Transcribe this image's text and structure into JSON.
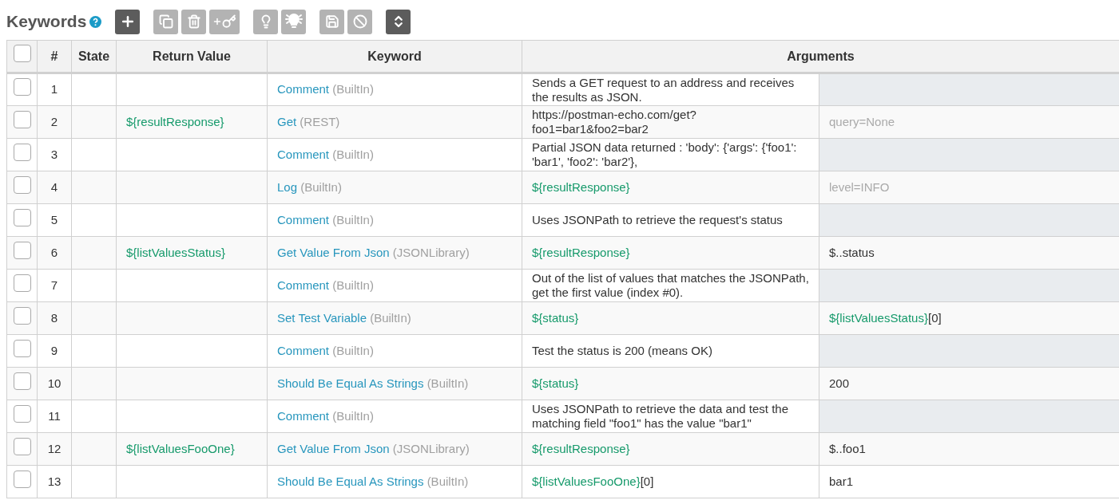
{
  "title": "Keywords",
  "toolbar": [
    [
      {
        "kind": "add",
        "disabled": false
      }
    ],
    [
      {
        "kind": "copy",
        "disabled": true
      },
      {
        "kind": "delete",
        "disabled": true
      },
      {
        "kind": "add-key",
        "disabled": true
      }
    ],
    [
      {
        "kind": "bulb",
        "disabled": true
      },
      {
        "kind": "bulb-on",
        "disabled": true
      }
    ],
    [
      {
        "kind": "save",
        "disabled": true
      },
      {
        "kind": "cancel",
        "disabled": true
      }
    ],
    [
      {
        "kind": "sort",
        "disabled": false
      }
    ]
  ],
  "table": {
    "select_all": {
      "checked": false
    },
    "columns": [
      "#",
      "State",
      "Return Value",
      "Keyword",
      "Arguments"
    ],
    "rows": [
      {
        "checked": false,
        "number": "1",
        "return_value": "",
        "keyword": {
          "name": "Comment",
          "library": "(BuiltIn)"
        },
        "arguments": [
          {
            "kind": "text",
            "segments": [
              {
                "text": "Sends a GET request to an address and receives the results as JSON.",
                "kind": "text"
              }
            ]
          },
          {
            "kind": "blank"
          }
        ]
      },
      {
        "checked": false,
        "number": "2",
        "return_value": "${resultResponse}",
        "keyword": {
          "name": "Get",
          "library": "(REST)"
        },
        "arguments": [
          {
            "kind": "text",
            "segments": [
              {
                "text": "https://postman-echo.com/get?foo1=bar1&foo2=bar2",
                "kind": "text"
              }
            ]
          },
          {
            "kind": "text",
            "segments": [
              {
                "text": "query=None",
                "kind": "default"
              }
            ]
          }
        ]
      },
      {
        "checked": false,
        "number": "3",
        "return_value": "",
        "keyword": {
          "name": "Comment",
          "library": "(BuiltIn)"
        },
        "arguments": [
          {
            "kind": "text",
            "segments": [
              {
                "text": "Partial JSON data returned : 'body': {'args': {'foo1': 'bar1', 'foo2': 'bar2'},",
                "kind": "text"
              }
            ]
          },
          {
            "kind": "blank"
          }
        ]
      },
      {
        "checked": false,
        "number": "4",
        "return_value": "",
        "keyword": {
          "name": "Log",
          "library": "(BuiltIn)"
        },
        "arguments": [
          {
            "kind": "text",
            "segments": [
              {
                "text": "${resultResponse}",
                "kind": "variable"
              }
            ]
          },
          {
            "kind": "text",
            "segments": [
              {
                "text": "level=INFO",
                "kind": "default"
              }
            ]
          }
        ]
      },
      {
        "checked": false,
        "number": "5",
        "return_value": "",
        "keyword": {
          "name": "Comment",
          "library": "(BuiltIn)"
        },
        "arguments": [
          {
            "kind": "text",
            "segments": [
              {
                "text": "Uses JSONPath to retrieve the request's status",
                "kind": "text"
              }
            ]
          },
          {
            "kind": "blank"
          }
        ]
      },
      {
        "checked": false,
        "number": "6",
        "return_value": "${listValuesStatus}",
        "keyword": {
          "name": "Get Value From Json",
          "library": "(JSONLibrary)"
        },
        "arguments": [
          {
            "kind": "text",
            "segments": [
              {
                "text": "${resultResponse}",
                "kind": "variable"
              }
            ]
          },
          {
            "kind": "text",
            "segments": [
              {
                "text": "$..status",
                "kind": "text"
              }
            ]
          }
        ]
      },
      {
        "checked": false,
        "number": "7",
        "return_value": "",
        "keyword": {
          "name": "Comment",
          "library": "(BuiltIn)"
        },
        "arguments": [
          {
            "kind": "text",
            "segments": [
              {
                "text": "Out of the list of values that matches the JSONPath, get the first value (index #0).",
                "kind": "text"
              }
            ]
          },
          {
            "kind": "blank"
          }
        ]
      },
      {
        "checked": false,
        "number": "8",
        "return_value": "",
        "keyword": {
          "name": "Set Test Variable",
          "library": "(BuiltIn)"
        },
        "arguments": [
          {
            "kind": "text",
            "segments": [
              {
                "text": "${status}",
                "kind": "variable"
              }
            ]
          },
          {
            "kind": "text",
            "segments": [
              {
                "text": "${listValuesStatus}",
                "kind": "variable"
              },
              {
                "text": "[0]",
                "kind": "text"
              }
            ]
          }
        ]
      },
      {
        "checked": false,
        "number": "9",
        "return_value": "",
        "keyword": {
          "name": "Comment",
          "library": "(BuiltIn)"
        },
        "arguments": [
          {
            "kind": "text",
            "segments": [
              {
                "text": "Test the status is 200 (means OK)",
                "kind": "text"
              }
            ]
          },
          {
            "kind": "blank"
          }
        ]
      },
      {
        "checked": false,
        "number": "10",
        "return_value": "",
        "keyword": {
          "name": "Should Be Equal As Strings",
          "library": "(BuiltIn)"
        },
        "arguments": [
          {
            "kind": "text",
            "segments": [
              {
                "text": "${status}",
                "kind": "variable"
              }
            ]
          },
          {
            "kind": "text",
            "segments": [
              {
                "text": "200",
                "kind": "text"
              }
            ]
          }
        ]
      },
      {
        "checked": false,
        "number": "11",
        "return_value": "",
        "keyword": {
          "name": "Comment",
          "library": "(BuiltIn)"
        },
        "arguments": [
          {
            "kind": "text",
            "segments": [
              {
                "text": "Uses JSONPath to retrieve the data and test the matching field \"foo1\" has the value \"bar1\"",
                "kind": "text"
              }
            ]
          },
          {
            "kind": "blank"
          }
        ]
      },
      {
        "checked": false,
        "number": "12",
        "return_value": "${listValuesFooOne}",
        "keyword": {
          "name": "Get Value From Json",
          "library": "(JSONLibrary)"
        },
        "arguments": [
          {
            "kind": "text",
            "segments": [
              {
                "text": "${resultResponse}",
                "kind": "variable"
              }
            ]
          },
          {
            "kind": "text",
            "segments": [
              {
                "text": "$..foo1",
                "kind": "text"
              }
            ]
          }
        ]
      },
      {
        "checked": false,
        "number": "13",
        "return_value": "",
        "keyword": {
          "name": "Should Be Equal As Strings",
          "library": "(BuiltIn)"
        },
        "arguments": [
          {
            "kind": "text",
            "segments": [
              {
                "text": "${listValuesFooOne}",
                "kind": "variable"
              },
              {
                "text": "[0]",
                "kind": "text"
              }
            ]
          },
          {
            "kind": "text",
            "segments": [
              {
                "text": "bar1",
                "kind": "text"
              }
            ]
          }
        ]
      }
    ]
  }
}
